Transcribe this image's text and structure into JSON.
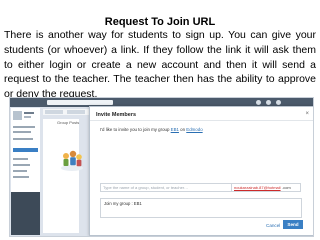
{
  "heading": "Request To Join URL",
  "paragraph": "There is another way for students to sign up. You can give your students (or whoever) a link. If they follow the link it will ask them to either login or create a new account and then it will send a request to the teacher. The teacher then has the ability to approve or deny the request.",
  "screenshot": {
    "sidebar": {
      "section_label": "Group Posts"
    },
    "dialog": {
      "title": "Invite Members",
      "close": "×",
      "message_prefix": "I'd like to invite you to join my group ",
      "group_name": "EB1",
      "message_mid": " on ",
      "service": "Edmodo",
      "search_placeholder": "Type the name of a group, student, or teacher…",
      "recipient": "noukarzainab.87@hotmail",
      "recipient_domain": ".com",
      "textarea_text": "Join my group : EB1",
      "cancel_label": "Cancel",
      "send_label": "Send"
    }
  }
}
